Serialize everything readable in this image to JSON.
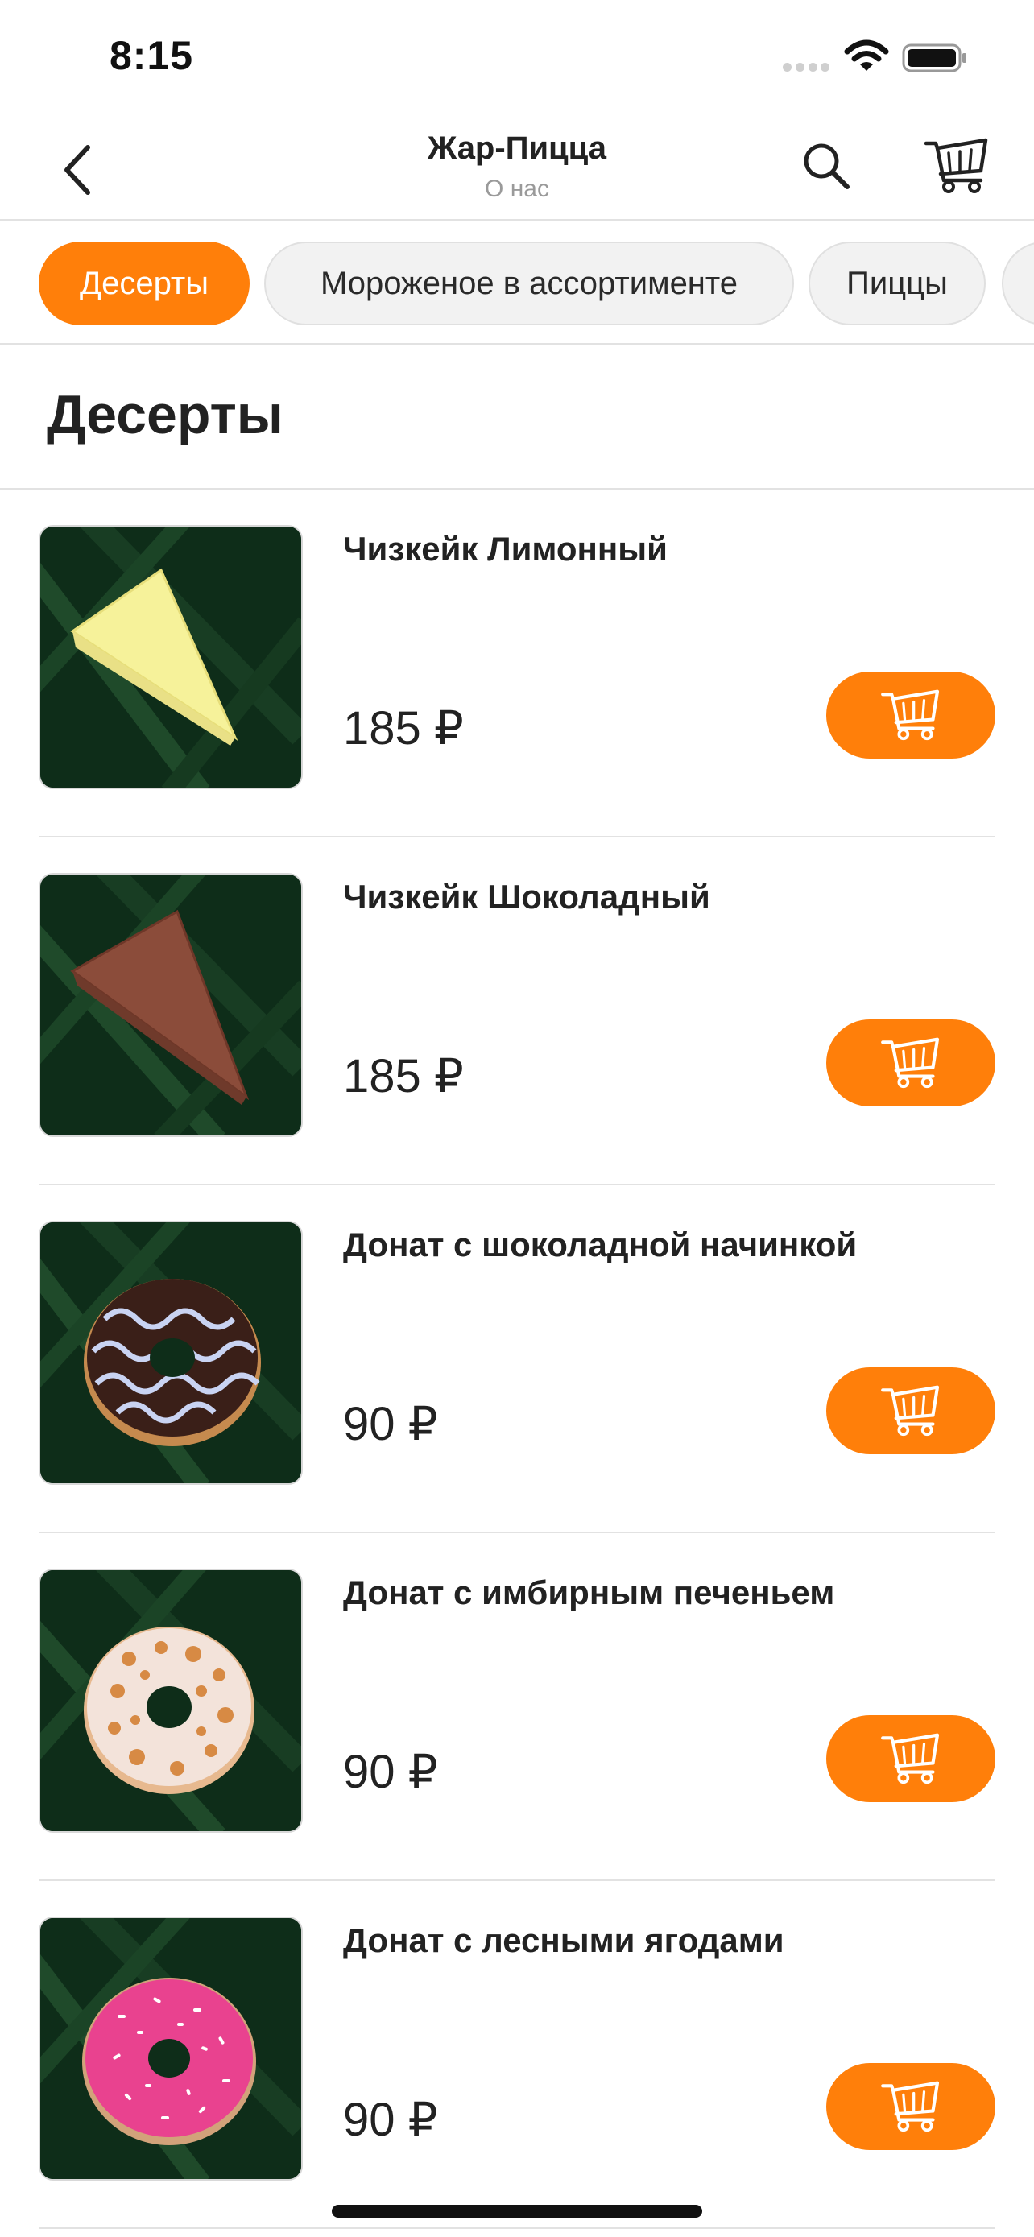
{
  "status_bar": {
    "time": "8:15"
  },
  "header": {
    "title": "Жар-Пицца",
    "subtitle": "О нас"
  },
  "tabs": [
    {
      "label": "Десерты",
      "active": true
    },
    {
      "label": "Мороженое в ассортименте",
      "active": false
    },
    {
      "label": "Пиццы",
      "active": false
    }
  ],
  "section": {
    "title": "Десерты"
  },
  "products": [
    {
      "name": "Чизкейк Лимонный",
      "price": "185 ₽",
      "image": "lemon-cheesecake"
    },
    {
      "name": "Чизкейк Шоколадный",
      "price": "185 ₽",
      "image": "chocolate-cheesecake"
    },
    {
      "name": "Донат с шоколадной начинкой",
      "price": "90 ₽",
      "image": "chocolate-donut"
    },
    {
      "name": "Донат с имбирным печеньем",
      "price": "90 ₽",
      "image": "ginger-cookie-donut"
    },
    {
      "name": "Донат с лесными ягодами",
      "price": "90 ₽",
      "image": "berry-donut"
    }
  ],
  "colors": {
    "accent": "#ff7f0a",
    "text": "#222222",
    "muted": "#9a9a9a",
    "divider": "#e2e2e2",
    "leaf_bg": "#0e2d19"
  },
  "icons": [
    "back-chevron-icon",
    "search-icon",
    "cart-icon",
    "add-to-cart-icon",
    "wifi-icon",
    "battery-icon",
    "signal-icon"
  ]
}
